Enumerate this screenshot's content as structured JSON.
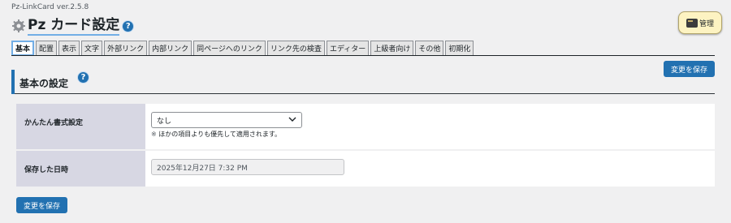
{
  "version": "Pz-LinkCard ver.2.5.8",
  "title": "Pz カード設定",
  "help_glyph": "?",
  "admin_button": {
    "label": "管理"
  },
  "tabs": [
    {
      "label": "基本",
      "active": true
    },
    {
      "label": "配置"
    },
    {
      "label": "表示"
    },
    {
      "label": "文字"
    },
    {
      "label": "外部リンク"
    },
    {
      "label": "内部リンク"
    },
    {
      "label": "同ページへのリンク"
    },
    {
      "label": "リンク先の検査"
    },
    {
      "label": "エディター"
    },
    {
      "label": "上級者向け"
    },
    {
      "label": "その他"
    },
    {
      "label": "初期化"
    }
  ],
  "save_button_label": "変更を保存",
  "section": {
    "title": "基本の設定"
  },
  "settings": {
    "format": {
      "label": "かんたん書式設定",
      "selected": "なし",
      "note_mark": "※",
      "note": "ほかの項目よりも優先して適用されます。"
    },
    "saved_date": {
      "label": "保存した日時",
      "value": "2025年12月27日 7:32 PM"
    }
  }
}
